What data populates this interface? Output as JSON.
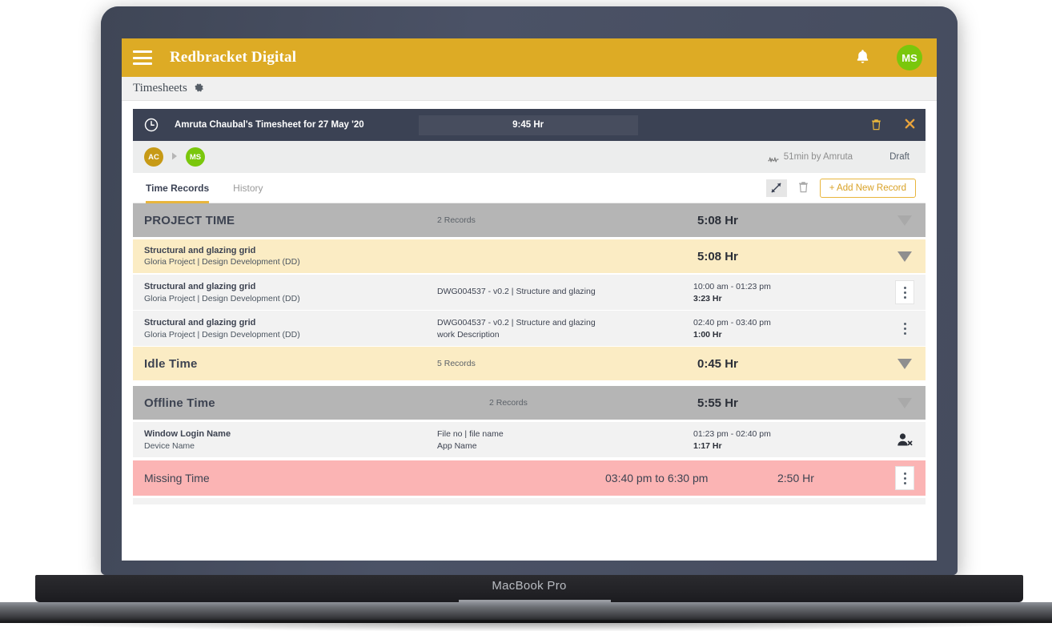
{
  "mockup": {
    "device_label": "MacBook Pro"
  },
  "topbar": {
    "app_title": "Redbracket Digital",
    "hamburger_icon": "hamburger-icon",
    "bell_icon": "bell-icon",
    "bell_glyph": "ὑ4",
    "avatar_initials": "MS",
    "avatar_color": "#7ac70c",
    "background_color": "#ddab25"
  },
  "breadcrumb": {
    "label": "Timesheets",
    "gear_icon": "gear-icon"
  },
  "timesheet_header": {
    "clock_icon": "clock-icon",
    "title": "Amruta Chaubal's Timesheet for 27 May '20",
    "total_hours": "9:45 Hr",
    "delete_icon": "trash-icon",
    "close_icon": "close-icon",
    "background_color": "#3b4254"
  },
  "timesheet_meta": {
    "avatars": [
      {
        "initials": "AC",
        "color": "#c79a16"
      },
      {
        "initials": "MS",
        "color": "#7ac70c"
      }
    ],
    "arrow_icon": "chevron-right-icon",
    "activity_icon": "pulse-icon",
    "edit_info": "51min by Amruta",
    "status": "Draft"
  },
  "tabs": {
    "items": [
      {
        "label": "Time Records",
        "active": true
      },
      {
        "label": "History",
        "active": false
      }
    ],
    "collapse_icon": "collapse-arrows-icon",
    "trash_icon": "trash-icon",
    "add_record_label": "+ Add New Record",
    "accent_color": "#e8b53c"
  },
  "rows": {
    "project_time": {
      "title": "PROJECT TIME",
      "records": "2 Records",
      "duration": "5:08 Hr",
      "chevron_icon": "chevron-down-icon"
    },
    "project_subtotal": {
      "title": "Structural and glazing grid",
      "subtitle": "Gloria Project  |  Design Development (DD)",
      "duration": "5:08 Hr",
      "chevron_icon": "chevron-down-icon"
    },
    "entries": [
      {
        "title": "Structural and glazing grid",
        "subtitle": "Gloria Project  |  Design Development (DD)",
        "ref": "DWG004537 - v0.2 | Structure and glazing",
        "ref_second": "",
        "time_range": "10:00 am - 01:23 pm",
        "duration": "3:23 Hr",
        "menu_icon": "kebab-menu-icon",
        "menu_boxed": true
      },
      {
        "title": "Structural and glazing grid",
        "subtitle": "Gloria Project  |  Design Development (DD)",
        "ref": "DWG004537 - v0.2 | Structure and glazing",
        "ref_second": "work Description",
        "time_range": "02:40 pm - 03:40 pm",
        "duration": "1:00 Hr",
        "menu_icon": "kebab-menu-icon",
        "menu_boxed": false
      }
    ],
    "idle_time": {
      "title": "Idle Time",
      "records": "5 Records",
      "duration": "0:45 Hr",
      "chevron_icon": "chevron-down-icon"
    },
    "offline_time": {
      "title": "Offline  Time",
      "records": "2 Records",
      "duration": "5:55 Hr",
      "chevron_icon": "chevron-down-icon"
    },
    "offline_entry": {
      "title": "Window Login Name",
      "subtitle": "Device Name",
      "ref": "File no | file name",
      "ref_second": "App Name",
      "time_range": "01:23 pm - 02:40 pm",
      "duration": "1:17 Hr",
      "action_icon": "user-remove-icon"
    },
    "missing_time": {
      "title": "Missing Time",
      "time_range": "03:40 pm to 6:30 pm",
      "duration": "2:50 Hr",
      "menu_icon": "kebab-menu-icon"
    }
  }
}
